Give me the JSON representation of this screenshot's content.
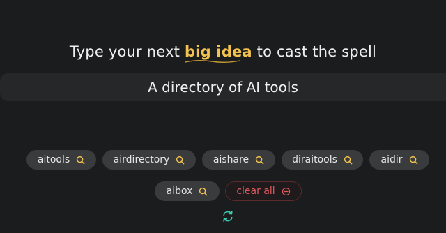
{
  "headline": {
    "before": "Type your next ",
    "highlight": "big idea",
    "after": " to cast the spell"
  },
  "idea_input": {
    "value": "A directory of AI tools"
  },
  "suggestions": [
    {
      "label": "aitools",
      "icon": "search-icon"
    },
    {
      "label": "airdirectory",
      "icon": "search-icon"
    },
    {
      "label": "aishare",
      "icon": "search-icon"
    },
    {
      "label": "diraitools",
      "icon": "search-icon"
    },
    {
      "label": "aidir",
      "icon": "search-icon"
    },
    {
      "label": "aibox",
      "icon": "search-icon"
    }
  ],
  "clear_button": {
    "label": "clear all",
    "icon": "minus-circle-icon"
  },
  "refresh": {
    "icon": "refresh-icon"
  },
  "colors": {
    "background": "#1b1c1d",
    "highlight": "#f4c34f",
    "chip": "#3a3b3d",
    "danger": "#e0595f",
    "refresh": "#3fc8b0"
  }
}
